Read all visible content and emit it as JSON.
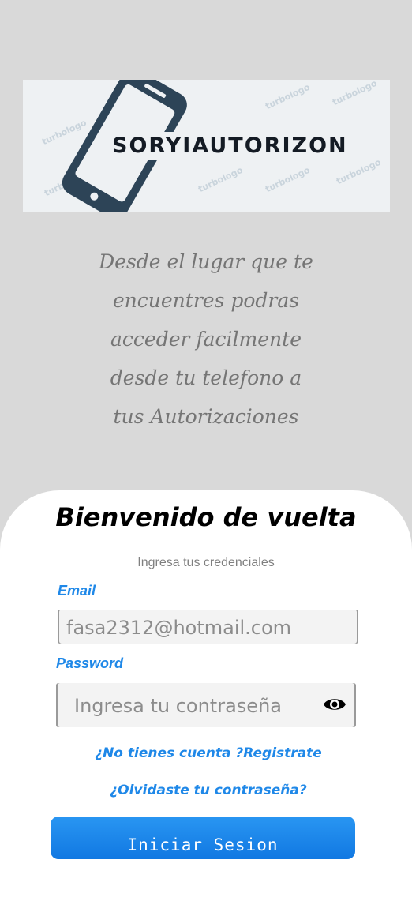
{
  "logo": {
    "brand": "SORYIAUTORIZON",
    "watermark": "turbologo"
  },
  "tagline": {
    "lines": [
      "Desde el lugar que te",
      "encuentres podras",
      "acceder facilmente",
      "desde tu telefono a",
      "tus Autorizaciones"
    ]
  },
  "login": {
    "title": "Bienvenido de vuelta",
    "subtitle": "Ingresa tus credenciales",
    "email_label": "Email",
    "email_value": "fasa2312@hotmail.com",
    "password_label": "Password",
    "password_placeholder": "Ingresa tu contraseña",
    "register_link": "¿No tienes cuenta ?Registrate",
    "forgot_link": "¿Olvidaste tu contraseña?",
    "submit_label": "Iniciar Sesion"
  },
  "colors": {
    "background": "#d9d9d9",
    "accent": "#1f88e8",
    "card": "#ffffff",
    "brand_dark": "#2d4457"
  },
  "icons": {
    "password_toggle": "eye-icon"
  }
}
